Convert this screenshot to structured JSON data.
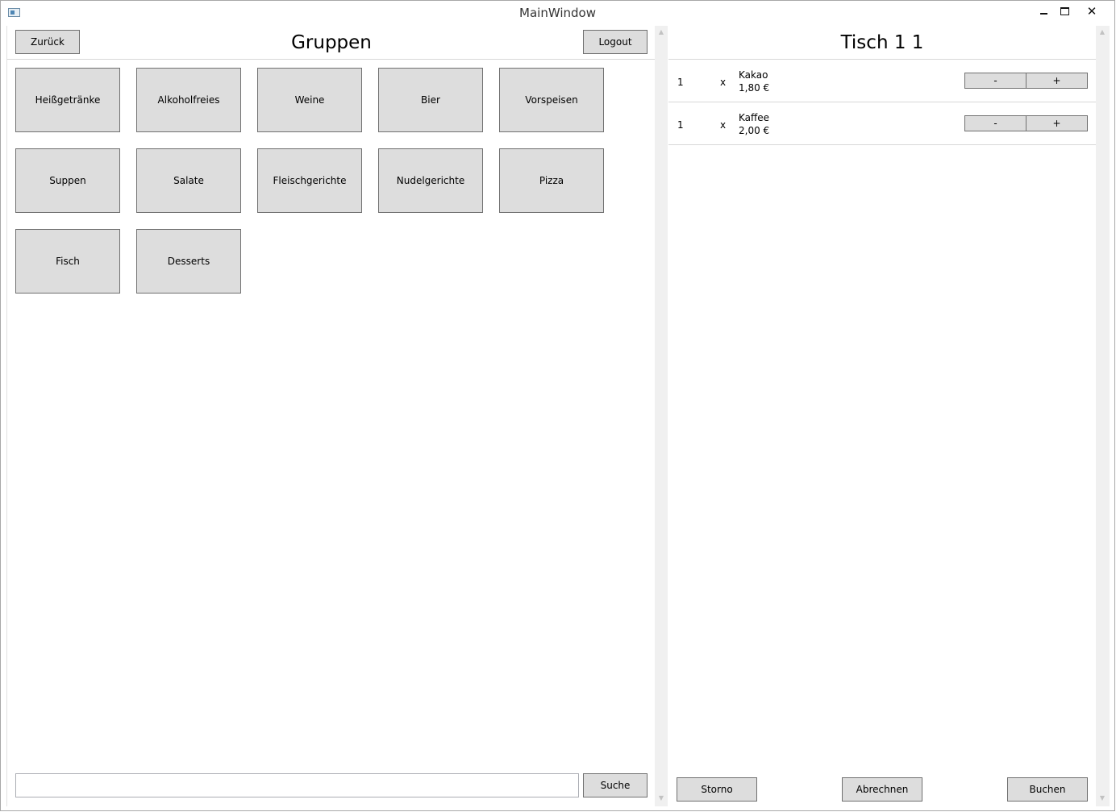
{
  "window": {
    "title": "MainWindow",
    "close_glyph": "✕"
  },
  "left": {
    "back_label": "Zurück",
    "title": "Gruppen",
    "logout_label": "Logout",
    "groups": [
      "Heißgetränke",
      "Alkoholfreies",
      "Weine",
      "Bier",
      "Vorspeisen",
      "Suppen",
      "Salate",
      "Fleischgerichte",
      "Nudelgerichte",
      "Pizza",
      "Fisch",
      "Desserts"
    ],
    "search_value": "",
    "search_label": "Suche"
  },
  "right": {
    "title": "Tisch 1 1",
    "orders": [
      {
        "qty": "1",
        "times": "x",
        "name": "Kakao",
        "price": "1,80 €",
        "minus": "-",
        "plus": "+"
      },
      {
        "qty": "1",
        "times": "x",
        "name": "Kaffee",
        "price": "2,00 €",
        "minus": "-",
        "plus": "+"
      }
    ],
    "storno_label": "Storno",
    "abrechnen_label": "Abrechnen",
    "buchen_label": "Buchen"
  },
  "scroll_arrows": {
    "up": "▲",
    "down": "▼"
  }
}
